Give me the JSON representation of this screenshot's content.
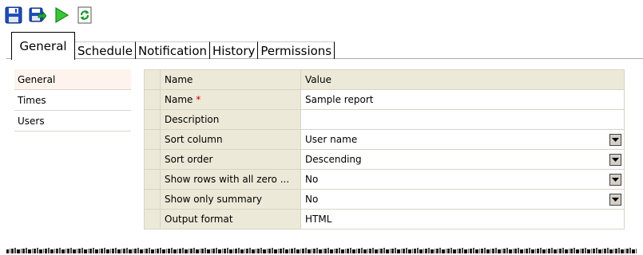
{
  "toolbar": {
    "icons": [
      "save-icon",
      "save-as-icon",
      "run-icon",
      "refresh-icon"
    ]
  },
  "tabs": [
    {
      "label": "General",
      "active": true
    },
    {
      "label": "Schedule",
      "active": false
    },
    {
      "label": "Notification",
      "active": false
    },
    {
      "label": "History",
      "active": false
    },
    {
      "label": "Permissions",
      "active": false
    }
  ],
  "sidebar": {
    "items": [
      {
        "label": "General",
        "selected": true
      },
      {
        "label": "Times",
        "selected": false
      },
      {
        "label": "Users",
        "selected": false
      }
    ]
  },
  "grid": {
    "headers": {
      "name": "Name",
      "value": "Value"
    },
    "rows": [
      {
        "name": "Name",
        "required_mark": "*",
        "value": "Sample report",
        "dropdown": false
      },
      {
        "name": "Description",
        "value": "",
        "dropdown": false
      },
      {
        "name": "Sort column",
        "value": "User name",
        "dropdown": true
      },
      {
        "name": "Sort order",
        "value": "Descending",
        "dropdown": true
      },
      {
        "name": "Show rows with all zero ...",
        "value": "No",
        "dropdown": true
      },
      {
        "name": "Show only summary",
        "value": "No",
        "dropdown": true
      },
      {
        "name": "Output format",
        "value": "HTML",
        "dropdown": false
      }
    ]
  },
  "colors": {
    "grid_header_bg": "#ece9d8",
    "required": "#d00000",
    "selected_sidebar": "#fff3ee"
  }
}
